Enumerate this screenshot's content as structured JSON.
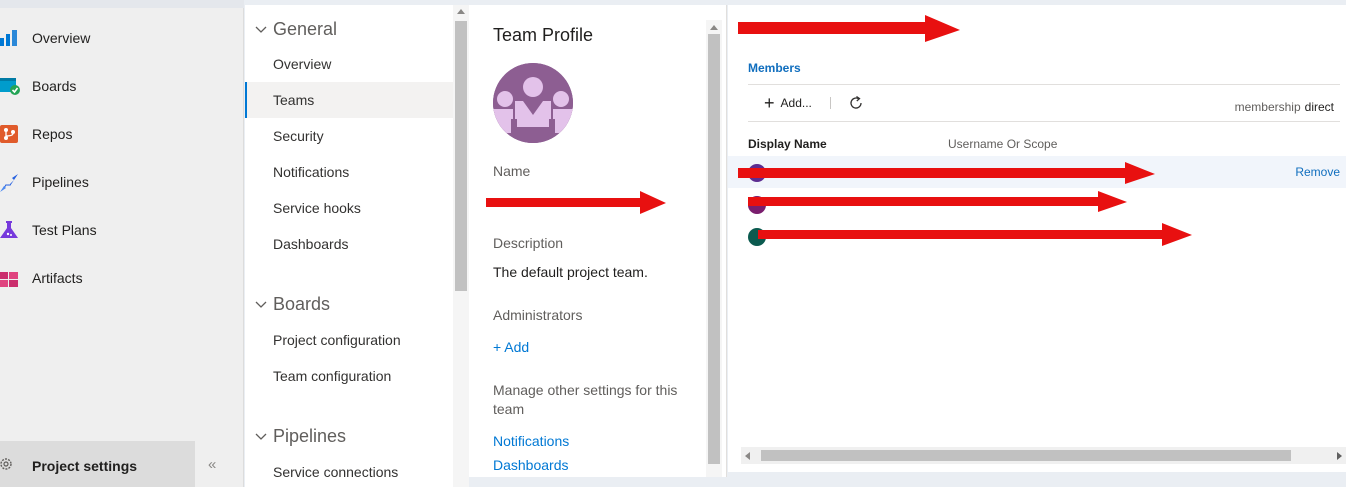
{
  "leftnav": {
    "items": [
      {
        "label": "Overview",
        "icon": "overview-icon"
      },
      {
        "label": "Boards",
        "icon": "boards-icon"
      },
      {
        "label": "Repos",
        "icon": "repos-icon"
      },
      {
        "label": "Pipelines",
        "icon": "pipelines-icon"
      },
      {
        "label": "Test Plans",
        "icon": "test-plans-icon"
      },
      {
        "label": "Artifacts",
        "icon": "artifacts-icon"
      }
    ],
    "project_settings": "Project settings",
    "collapse_glyph": "«"
  },
  "settings": {
    "groups": [
      {
        "title": "General",
        "items": [
          "Overview",
          "Teams",
          "Security",
          "Notifications",
          "Service hooks",
          "Dashboards"
        ]
      },
      {
        "title": "Boards",
        "items": [
          "Project configuration",
          "Team configuration"
        ]
      },
      {
        "title": "Pipelines",
        "items": [
          "Service connections"
        ]
      }
    ],
    "active_item": "Teams"
  },
  "profile": {
    "title": "Team Profile",
    "name_label": "Name",
    "description_label": "Description",
    "description": "The default project team.",
    "administrators_label": "Administrators",
    "add_label": "+ Add",
    "manage_label": "Manage other settings for this team",
    "links": [
      "Notifications",
      "Dashboards"
    ]
  },
  "members": {
    "tab": "Members",
    "add_label": "Add...",
    "membership_label": "membership",
    "membership_value": "direct",
    "col_display_name": "Display Name",
    "col_scope": "Username Or Scope",
    "remove_label": "Remove",
    "rows": [
      {
        "avatar_color": "#5c2d91"
      },
      {
        "avatar_color": "#7a1e6e"
      },
      {
        "avatar_color": "#0b5a4f"
      }
    ]
  },
  "colors": {
    "accent": "#0078d4",
    "link": "#106ebe",
    "redaction": "#e81010"
  }
}
